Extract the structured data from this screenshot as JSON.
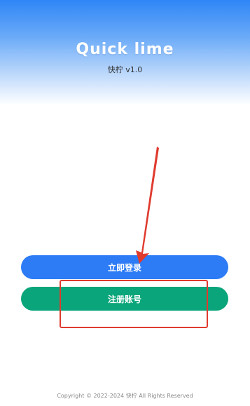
{
  "app": {
    "logo_text": "Quick lime",
    "version_text": "快柠 v1.0"
  },
  "actions": {
    "login_label": "立即登录",
    "register_label": "注册账号"
  },
  "footer": {
    "copyright": "Copyright © 2022-2024 快柠 All Rights Reserved"
  },
  "colors": {
    "header_gradient_top": "#2f86f6",
    "login_button": "#2d7cf6",
    "register_button": "#0aa57a",
    "annotation": "#e03a2e"
  }
}
